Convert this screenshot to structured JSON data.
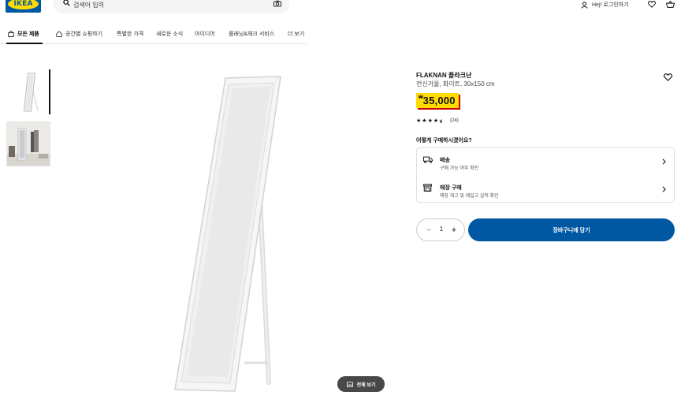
{
  "header": {
    "logo_text": "IKEA",
    "search": {
      "placeholder": "검색어 입력"
    },
    "login_label": "Hej! 로그인하기"
  },
  "nav": {
    "items": [
      {
        "label": "모든 제품"
      },
      {
        "label": "공간별 쇼핑하기"
      },
      {
        "label": "특별한 가격"
      },
      {
        "label": "새로운 소식"
      },
      {
        "label": "아이디어"
      },
      {
        "label": "플래닝&체크 서비스"
      },
      {
        "label": "더 보기"
      }
    ]
  },
  "gallery": {
    "full_view_label": "전체 보기"
  },
  "product": {
    "name": "FLAKNAN 플라크난",
    "description": "전신거울, 화이트, 30x150 cm",
    "currency_symbol": "₩",
    "price": "35,000",
    "rating": 4.5,
    "review_count": "(24)",
    "buy_question": "어떻게 구매하시겠어요?",
    "options": [
      {
        "title": "배송",
        "subtitle": "구매 가능 여부 확인"
      },
      {
        "title": "매장 구매",
        "subtitle": "매장 재고 및 제일고 실적 확인"
      }
    ],
    "quantity": "1",
    "add_to_cart_label": "장바구니에 담기"
  },
  "colors": {
    "brand_blue": "#0058a3",
    "brand_yellow": "#ffdb00",
    "price_shadow": "#cc0008"
  }
}
